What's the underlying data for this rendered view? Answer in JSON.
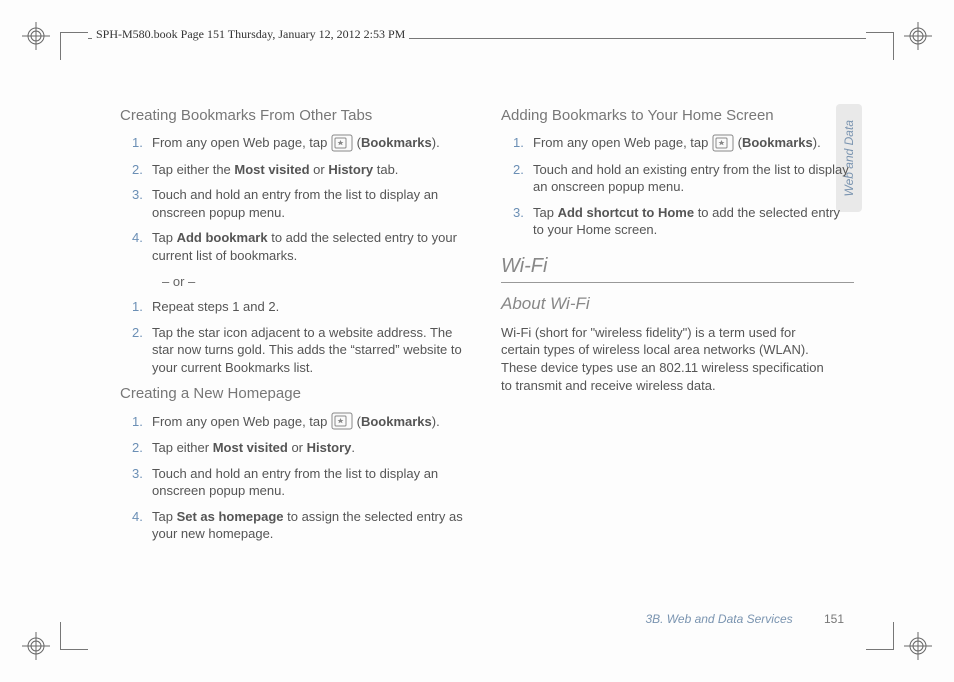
{
  "header": "SPH-M580.book  Page 151  Thursday, January 12, 2012  2:53 PM",
  "side_tab": "Web and Data",
  "footer": {
    "section": "3B. Web and Data Services",
    "page": "151"
  },
  "left_col": {
    "h1": "Creating Bookmarks From Other Tabs",
    "l1_1a": "From any open Web page, tap ",
    "l1_1b": " (",
    "l1_1c": "Bookmarks",
    "l1_1d": ").",
    "l1_2a": "Tap either the ",
    "l1_2b": "Most visited",
    "l1_2c": " or ",
    "l1_2d": "History",
    "l1_2e": " tab.",
    "l1_3": "Touch and hold an entry from the list to display an onscreen popup menu.",
    "l1_4a": "Tap ",
    "l1_4b": "Add bookmark",
    "l1_4c": " to add the selected entry to your current list of bookmarks.",
    "or": "– or –",
    "l2_1": "Repeat steps 1 and 2.",
    "l2_2": "Tap the star icon adjacent to a website address. The star now turns gold. This adds the “starred” website to your current Bookmarks list.",
    "h2": "Creating a New Homepage",
    "l3_1a": "From any open Web page, tap ",
    "l3_1b": " (",
    "l3_1c": "Bookmarks",
    "l3_1d": ").",
    "l3_2a": "Tap either ",
    "l3_2b": "Most visited",
    "l3_2c": " or ",
    "l3_2d": "History",
    "l3_2e": ".",
    "l3_3": "Touch and hold an entry from the list to display an onscreen popup menu.",
    "l3_4a": "Tap ",
    "l3_4b": "Set as homepage",
    "l3_4c": " to assign the selected entry as your new homepage."
  },
  "right_col": {
    "h1": "Adding Bookmarks to Your Home Screen",
    "r1_1a": "From any open Web page, tap ",
    "r1_1b": " (",
    "r1_1c": "Bookmarks",
    "r1_1d": ").",
    "r1_2": "Touch and hold an existing entry from the list to display an onscreen popup menu.",
    "r1_3a": "Tap ",
    "r1_3b": "Add shortcut to Home",
    "r1_3c": " to add the selected entry to your Home screen.",
    "section_title": "Wi-Fi",
    "section_sub": "About Wi-Fi",
    "para": "Wi-Fi (short for \"wireless fidelity\") is a term used for certain types of wireless local area networks (WLAN). These device types use an 802.11 wireless specification to transmit and receive wireless data."
  }
}
